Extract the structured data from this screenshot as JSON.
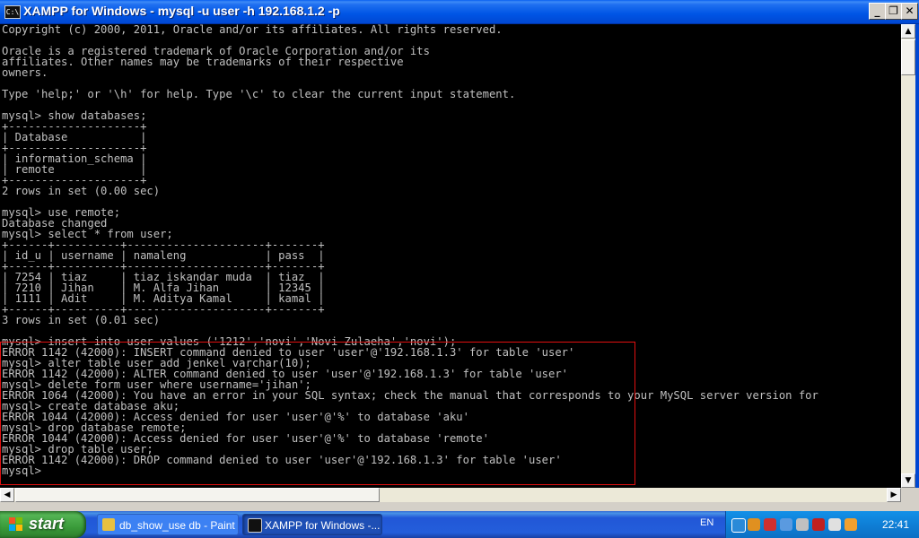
{
  "window": {
    "title": "XAMPP for Windows - mysql -u user -h 192.168.1.2 -p",
    "icon_label": "C:\\"
  },
  "console": {
    "lines": [
      "Copyright (c) 2000, 2011, Oracle and/or its affiliates. All rights reserved.",
      "",
      "Oracle is a registered trademark of Oracle Corporation and/or its",
      "affiliates. Other names may be trademarks of their respective",
      "owners.",
      "",
      "Type 'help;' or '\\h' for help. Type '\\c' to clear the current input statement.",
      "",
      "mysql> show databases;",
      "+--------------------+",
      "| Database           |",
      "+--------------------+",
      "| information_schema |",
      "| remote             |",
      "+--------------------+",
      "2 rows in set (0.00 sec)",
      "",
      "mysql> use remote;",
      "Database changed",
      "mysql> select * from user;",
      "+------+----------+---------------------+-------+",
      "| id_u | username | namaleng            | pass  |",
      "+------+----------+---------------------+-------+",
      "| 7254 | tiaz     | tiaz iskandar muda  | tiaz  |",
      "| 7210 | Jihan    | M. Alfa Jihan       | 12345 |",
      "| 1111 | Adit     | M. Aditya Kamal     | kamal |",
      "+------+----------+---------------------+-------+",
      "3 rows in set (0.01 sec)",
      "",
      "mysql> insert into user values ('1212','novi','Novi Zulaeha','novi');",
      "ERROR 1142 (42000): INSERT command denied to user 'user'@'192.168.1.3' for table 'user'",
      "mysql> alter table user add jenkel varchar(10);",
      "ERROR 1142 (42000): ALTER command denied to user 'user'@'192.168.1.3' for table 'user'",
      "mysql> delete form user where username='jihan';",
      "ERROR 1064 (42000): You have an error in your SQL syntax; check the manual that corresponds to your MySQL server version for",
      "mysql> create database aku;",
      "ERROR 1044 (42000): Access denied for user 'user'@'%' to database 'aku'",
      "mysql> drop database remote;",
      "ERROR 1044 (42000): Access denied for user 'user'@'%' to database 'remote'",
      "mysql> drop table user;",
      "ERROR 1142 (42000): DROP command denied to user 'user'@'192.168.1.3' for table 'user'",
      "mysql>"
    ]
  },
  "scrollbars": {
    "up_arrow": "▲",
    "down_arrow": "▼",
    "left_arrow": "◀",
    "right_arrow": "▶"
  },
  "window_buttons": {
    "minimize": "_",
    "maximize": "❐",
    "close": "✕"
  },
  "taskbar": {
    "start_label": "start",
    "tasks": [
      {
        "label": "db_show_use db - Paint"
      },
      {
        "label": "XAMPP for Windows -..."
      }
    ],
    "language": "EN",
    "clock": "22:41"
  },
  "colors": {
    "console_text": "#c0c0c0",
    "highlight_border": "#e01010",
    "title_bar": "#0055e5",
    "taskbar": "#245edb",
    "start_button": "#3a9b3a"
  }
}
